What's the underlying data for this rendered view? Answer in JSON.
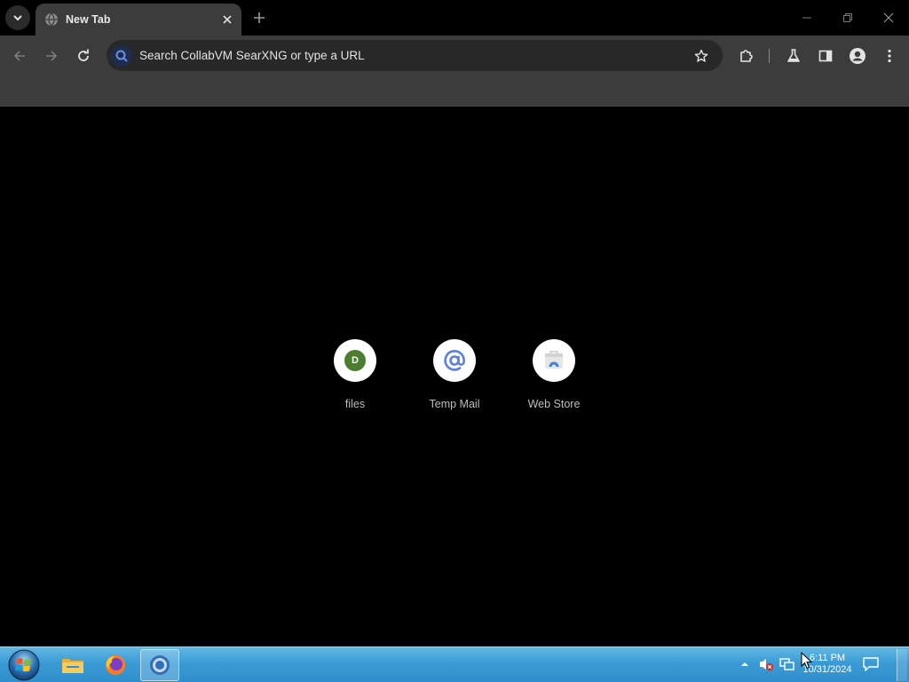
{
  "browser": {
    "tab": {
      "title": "New Tab"
    },
    "omnibox": {
      "placeholder": "Search CollabVM SearXNG or type a URL"
    }
  },
  "shortcuts": [
    {
      "label": "files",
      "badge": "D"
    },
    {
      "label": "Temp Mail"
    },
    {
      "label": "Web Store"
    }
  ],
  "taskbar": {
    "clock": {
      "time": "6:11 PM",
      "date": "10/31/2024"
    }
  },
  "colors": {
    "toolbar": "#3c3c3c",
    "page_background": "#000000",
    "shortcut_badge_green": "#4a7d2e",
    "temp_mail_blue": "#5b7fe0",
    "taskbar_blue": "#3a9bd4"
  },
  "icons": [
    "tab-search-icon",
    "globe-icon",
    "close-icon",
    "plus-icon",
    "minimize-icon",
    "restore-icon",
    "back-arrow-icon",
    "forward-arrow-icon",
    "reload-icon",
    "search-icon",
    "star-icon",
    "puzzle-icon",
    "flask-icon",
    "side-panel-icon",
    "profile-icon",
    "kebab-menu-icon",
    "at-sign-icon",
    "web-store-icon",
    "windows-orb-icon",
    "folder-icon",
    "firefox-icon",
    "chrome-icon",
    "chevron-up-icon",
    "speaker-muted-icon",
    "network-icon",
    "notification-icon"
  ]
}
